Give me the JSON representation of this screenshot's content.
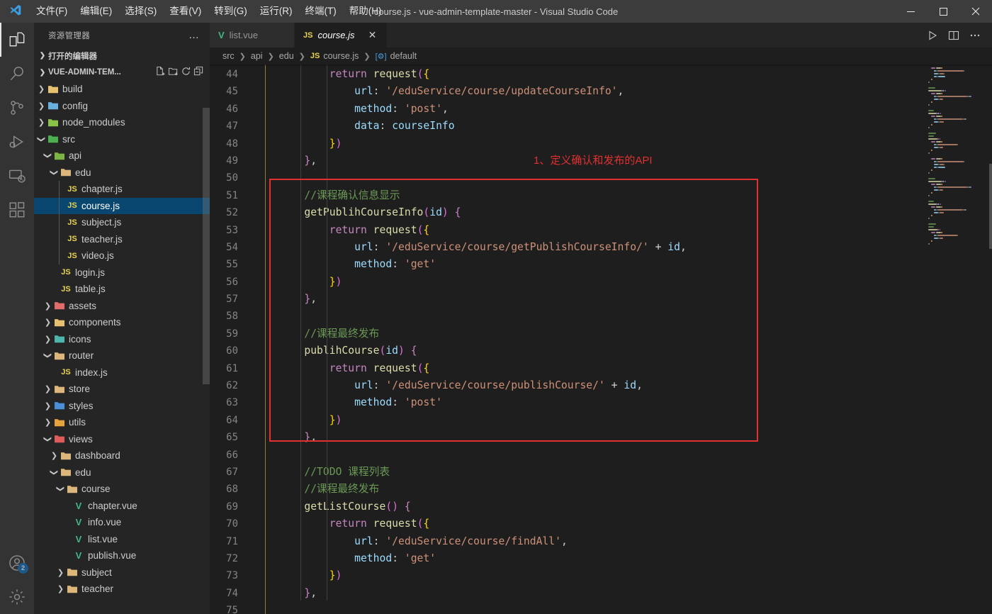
{
  "window": {
    "title": "course.js - vue-admin-template-master - Visual Studio Code",
    "logo_icon": "vscode-logo",
    "minimize_label": "─",
    "maximize_label": "□",
    "close_label": "✕"
  },
  "menu": [
    {
      "label": "文件(F)",
      "name": "menu-file"
    },
    {
      "label": "编辑(E)",
      "name": "menu-edit"
    },
    {
      "label": "选择(S)",
      "name": "menu-selection"
    },
    {
      "label": "查看(V)",
      "name": "menu-view"
    },
    {
      "label": "转到(G)",
      "name": "menu-go"
    },
    {
      "label": "运行(R)",
      "name": "menu-run"
    },
    {
      "label": "终端(T)",
      "name": "menu-terminal"
    },
    {
      "label": "帮助(H)",
      "name": "menu-help"
    }
  ],
  "activitybar": [
    {
      "icon": "explorer-files-icon",
      "active": true
    },
    {
      "icon": "search-icon",
      "active": false
    },
    {
      "icon": "source-control-branch-icon",
      "active": false
    },
    {
      "icon": "run-and-debug-icon",
      "active": false
    },
    {
      "icon": "remote-explorer-icon",
      "active": false
    },
    {
      "icon": "extensions-icon",
      "active": false
    },
    {
      "icon": "account-icon",
      "active": false,
      "badge": "2"
    },
    {
      "icon": "settings-gear-icon",
      "active": false
    }
  ],
  "sidebar": {
    "title": "资源管理器",
    "more_actions": "…",
    "open_editors_label": "打开的编辑器",
    "root_label": "VUE-ADMIN-TEM...",
    "root_actions": [
      "new-file-icon",
      "new-folder-icon",
      "refresh-icon",
      "collapse-all-icon"
    ],
    "tree": [
      {
        "label": "build",
        "type": "folder",
        "depth": 1,
        "expanded": false,
        "icon_color": "#e8c170"
      },
      {
        "label": "config",
        "type": "folder",
        "depth": 1,
        "expanded": false,
        "icon_color": "#6ab0de"
      },
      {
        "label": "node_modules",
        "type": "folder",
        "depth": 1,
        "expanded": false,
        "icon_color": "#8bc34a"
      },
      {
        "label": "src",
        "type": "folder",
        "depth": 1,
        "expanded": true,
        "icon_color": "#4caf50"
      },
      {
        "label": "api",
        "type": "folder",
        "depth": 2,
        "expanded": true,
        "icon_color": "#7cb342"
      },
      {
        "label": "edu",
        "type": "folder",
        "depth": 3,
        "expanded": true,
        "icon_color": "#dcb67a"
      },
      {
        "label": "chapter.js",
        "type": "js",
        "depth": 4,
        "selected": false
      },
      {
        "label": "course.js",
        "type": "js",
        "depth": 4,
        "selected": true
      },
      {
        "label": "subject.js",
        "type": "js",
        "depth": 4,
        "selected": false
      },
      {
        "label": "teacher.js",
        "type": "js",
        "depth": 4,
        "selected": false
      },
      {
        "label": "video.js",
        "type": "js",
        "depth": 4,
        "selected": false
      },
      {
        "label": "login.js",
        "type": "js",
        "depth": 3,
        "selected": false
      },
      {
        "label": "table.js",
        "type": "js",
        "depth": 3,
        "selected": false
      },
      {
        "label": "assets",
        "type": "folder",
        "depth": 2,
        "expanded": false,
        "icon_color": "#e06c6c"
      },
      {
        "label": "components",
        "type": "folder",
        "depth": 2,
        "expanded": false,
        "icon_color": "#e8c170"
      },
      {
        "label": "icons",
        "type": "folder",
        "depth": 2,
        "expanded": false,
        "icon_color": "#4db6ac"
      },
      {
        "label": "router",
        "type": "folder",
        "depth": 2,
        "expanded": true,
        "icon_color": "#dcb67a"
      },
      {
        "label": "index.js",
        "type": "js",
        "depth": 3,
        "selected": false
      },
      {
        "label": "store",
        "type": "folder",
        "depth": 2,
        "expanded": false,
        "icon_color": "#dcb67a"
      },
      {
        "label": "styles",
        "type": "folder",
        "depth": 2,
        "expanded": false,
        "icon_color": "#4a90d9"
      },
      {
        "label": "utils",
        "type": "folder",
        "depth": 2,
        "expanded": false,
        "icon_color": "#e8a33d"
      },
      {
        "label": "views",
        "type": "folder",
        "depth": 2,
        "expanded": true,
        "icon_color": "#e05c5c"
      },
      {
        "label": "dashboard",
        "type": "folder",
        "depth": 3,
        "expanded": false,
        "icon_color": "#dcb67a"
      },
      {
        "label": "edu",
        "type": "folder",
        "depth": 3,
        "expanded": true,
        "icon_color": "#dcb67a"
      },
      {
        "label": "course",
        "type": "folder",
        "depth": 4,
        "expanded": true,
        "icon_color": "#dcb67a"
      },
      {
        "label": "chapter.vue",
        "type": "vue",
        "depth": 5,
        "selected": false
      },
      {
        "label": "info.vue",
        "type": "vue",
        "depth": 5,
        "selected": false
      },
      {
        "label": "list.vue",
        "type": "vue",
        "depth": 5,
        "selected": false
      },
      {
        "label": "publish.vue",
        "type": "vue",
        "depth": 5,
        "selected": false
      },
      {
        "label": "subject",
        "type": "folder",
        "depth": 4,
        "expanded": false,
        "icon_color": "#dcb67a"
      },
      {
        "label": "teacher",
        "type": "folder",
        "depth": 4,
        "expanded": false,
        "icon_color": "#dcb67a"
      }
    ]
  },
  "tabs": [
    {
      "label": "list.vue",
      "icon": "vue-file-icon",
      "active": false,
      "italic": false
    },
    {
      "label": "course.js",
      "icon": "js-file-icon",
      "active": true,
      "italic": true
    }
  ],
  "tab_actions": [
    "run-play-icon",
    "split-editor-icon",
    "more-actions-icon"
  ],
  "breadcrumb": [
    {
      "label": "src",
      "icon": null
    },
    {
      "label": "api",
      "icon": null
    },
    {
      "label": "edu",
      "icon": null
    },
    {
      "label": "course.js",
      "icon": "js-file-icon"
    },
    {
      "label": "default",
      "icon": "symbol-object-icon"
    }
  ],
  "editor": {
    "first_line": 44,
    "annotation_text": "1、定义确认和发布的API",
    "annotation_color": "#e03030",
    "lines": [
      {
        "n": 44,
        "tokens": [
          [
            "        ",
            ""
          ],
          [
            "return",
            "t-kw"
          ],
          [
            " ",
            ""
          ],
          [
            "request",
            "t-fn"
          ],
          [
            "(",
            "t-pur"
          ],
          [
            "{",
            "t-yel"
          ]
        ]
      },
      {
        "n": 45,
        "tokens": [
          [
            "            ",
            ""
          ],
          [
            "url",
            "t-prop"
          ],
          [
            ": ",
            "t-punc"
          ],
          [
            "'/eduService/course/updateCourseInfo'",
            "t-str"
          ],
          [
            ",",
            "t-punc"
          ]
        ]
      },
      {
        "n": 46,
        "tokens": [
          [
            "            ",
            ""
          ],
          [
            "method",
            "t-prop"
          ],
          [
            ": ",
            "t-punc"
          ],
          [
            "'post'",
            "t-str"
          ],
          [
            ",",
            "t-punc"
          ]
        ]
      },
      {
        "n": 47,
        "tokens": [
          [
            "            ",
            ""
          ],
          [
            "data",
            "t-prop"
          ],
          [
            ": ",
            "t-punc"
          ],
          [
            "courseInfo",
            "t-var"
          ]
        ]
      },
      {
        "n": 48,
        "tokens": [
          [
            "        ",
            ""
          ],
          [
            "}",
            "t-yel"
          ],
          [
            ")",
            "t-pur"
          ]
        ]
      },
      {
        "n": 49,
        "tokens": [
          [
            "    ",
            ""
          ],
          [
            "}",
            "t-pink"
          ],
          [
            ",",
            "t-punc"
          ]
        ]
      },
      {
        "n": 50,
        "tokens": [
          [
            "",
            ""
          ]
        ]
      },
      {
        "n": 51,
        "tokens": [
          [
            "    ",
            ""
          ],
          [
            "//课程确认信息显示",
            "t-cmt"
          ]
        ]
      },
      {
        "n": 52,
        "tokens": [
          [
            "    ",
            ""
          ],
          [
            "getPublihCourseInfo",
            "t-fn"
          ],
          [
            "(",
            "t-pur"
          ],
          [
            "id",
            "t-var"
          ],
          [
            ")",
            "t-pur"
          ],
          [
            " ",
            ""
          ],
          [
            "{",
            "t-pink"
          ]
        ]
      },
      {
        "n": 53,
        "tokens": [
          [
            "        ",
            ""
          ],
          [
            "return",
            "t-kw"
          ],
          [
            " ",
            ""
          ],
          [
            "request",
            "t-fn"
          ],
          [
            "(",
            "t-pur"
          ],
          [
            "{",
            "t-yel"
          ]
        ]
      },
      {
        "n": 54,
        "tokens": [
          [
            "            ",
            ""
          ],
          [
            "url",
            "t-prop"
          ],
          [
            ": ",
            "t-punc"
          ],
          [
            "'/eduService/course/getPublishCourseInfo/'",
            "t-str"
          ],
          [
            " + ",
            "t-op"
          ],
          [
            "id",
            "t-var"
          ],
          [
            ",",
            "t-punc"
          ]
        ]
      },
      {
        "n": 55,
        "tokens": [
          [
            "            ",
            ""
          ],
          [
            "method",
            "t-prop"
          ],
          [
            ": ",
            "t-punc"
          ],
          [
            "'get'",
            "t-str"
          ]
        ]
      },
      {
        "n": 56,
        "tokens": [
          [
            "        ",
            ""
          ],
          [
            "}",
            "t-yel"
          ],
          [
            ")",
            "t-pur"
          ]
        ]
      },
      {
        "n": 57,
        "tokens": [
          [
            "    ",
            ""
          ],
          [
            "}",
            "t-pink"
          ],
          [
            ",",
            "t-punc"
          ]
        ]
      },
      {
        "n": 58,
        "tokens": [
          [
            "",
            ""
          ]
        ]
      },
      {
        "n": 59,
        "tokens": [
          [
            "    ",
            ""
          ],
          [
            "//课程最终发布",
            "t-cmt"
          ]
        ]
      },
      {
        "n": 60,
        "tokens": [
          [
            "    ",
            ""
          ],
          [
            "publihCourse",
            "t-fn"
          ],
          [
            "(",
            "t-pur"
          ],
          [
            "id",
            "t-var"
          ],
          [
            ")",
            "t-pur"
          ],
          [
            " ",
            ""
          ],
          [
            "{",
            "t-pink"
          ]
        ]
      },
      {
        "n": 61,
        "tokens": [
          [
            "        ",
            ""
          ],
          [
            "return",
            "t-kw"
          ],
          [
            " ",
            ""
          ],
          [
            "request",
            "t-fn"
          ],
          [
            "(",
            "t-pur"
          ],
          [
            "{",
            "t-yel"
          ]
        ]
      },
      {
        "n": 62,
        "tokens": [
          [
            "            ",
            ""
          ],
          [
            "url",
            "t-prop"
          ],
          [
            ": ",
            "t-punc"
          ],
          [
            "'/eduService/course/publishCourse/'",
            "t-str"
          ],
          [
            " + ",
            "t-op"
          ],
          [
            "id",
            "t-var"
          ],
          [
            ",",
            "t-punc"
          ]
        ]
      },
      {
        "n": 63,
        "tokens": [
          [
            "            ",
            ""
          ],
          [
            "method",
            "t-prop"
          ],
          [
            ": ",
            "t-punc"
          ],
          [
            "'post'",
            "t-str"
          ]
        ]
      },
      {
        "n": 64,
        "tokens": [
          [
            "        ",
            ""
          ],
          [
            "}",
            "t-yel"
          ],
          [
            ")",
            "t-pur"
          ]
        ]
      },
      {
        "n": 65,
        "tokens": [
          [
            "    ",
            ""
          ],
          [
            "}",
            "t-pink"
          ],
          [
            ",",
            "t-punc"
          ]
        ]
      },
      {
        "n": 66,
        "tokens": [
          [
            "",
            ""
          ]
        ]
      },
      {
        "n": 67,
        "tokens": [
          [
            "    ",
            ""
          ],
          [
            "//TODO 课程列表",
            "t-cmt"
          ]
        ]
      },
      {
        "n": 68,
        "tokens": [
          [
            "    ",
            ""
          ],
          [
            "//课程最终发布",
            "t-cmt"
          ]
        ]
      },
      {
        "n": 69,
        "tokens": [
          [
            "    ",
            ""
          ],
          [
            "getListCourse",
            "t-fn"
          ],
          [
            "(",
            "t-pur"
          ],
          [
            ")",
            "t-pur"
          ],
          [
            " ",
            ""
          ],
          [
            "{",
            "t-pink"
          ]
        ]
      },
      {
        "n": 70,
        "tokens": [
          [
            "        ",
            ""
          ],
          [
            "return",
            "t-kw"
          ],
          [
            " ",
            ""
          ],
          [
            "request",
            "t-fn"
          ],
          [
            "(",
            "t-pur"
          ],
          [
            "{",
            "t-yel"
          ]
        ]
      },
      {
        "n": 71,
        "tokens": [
          [
            "            ",
            ""
          ],
          [
            "url",
            "t-prop"
          ],
          [
            ": ",
            "t-punc"
          ],
          [
            "'/eduService/course/findAll'",
            "t-str"
          ],
          [
            ",",
            "t-punc"
          ]
        ]
      },
      {
        "n": 72,
        "tokens": [
          [
            "            ",
            ""
          ],
          [
            "method",
            "t-prop"
          ],
          [
            ": ",
            "t-punc"
          ],
          [
            "'get'",
            "t-str"
          ]
        ]
      },
      {
        "n": 73,
        "tokens": [
          [
            "        ",
            ""
          ],
          [
            "}",
            "t-yel"
          ],
          [
            ")",
            "t-pur"
          ]
        ]
      },
      {
        "n": 74,
        "tokens": [
          [
            "    ",
            ""
          ],
          [
            "}",
            "t-pink"
          ],
          [
            ",",
            "t-punc"
          ]
        ]
      },
      {
        "n": 75,
        "tokens": [
          [
            "",
            ""
          ]
        ]
      }
    ]
  }
}
